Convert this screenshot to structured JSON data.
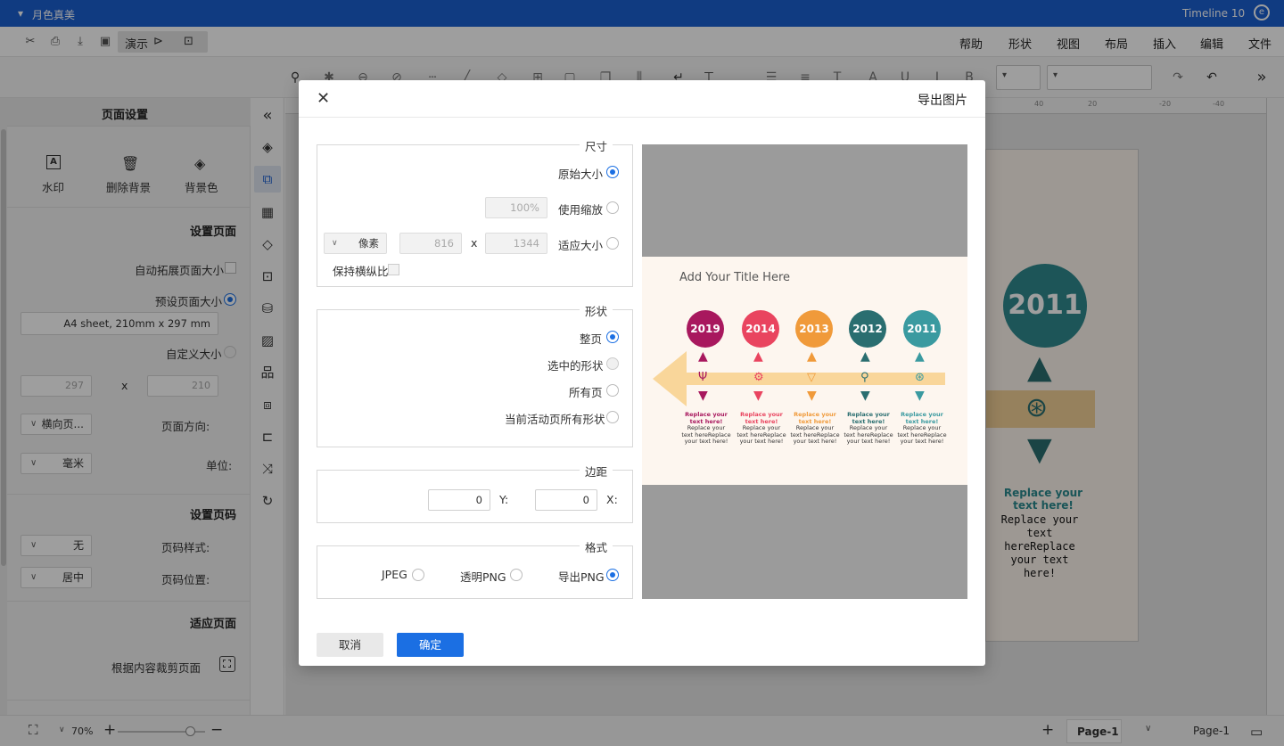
{
  "app": {
    "title": "Timeline 10",
    "user": "月色真美"
  },
  "menu": {
    "items": [
      "文件",
      "编辑",
      "插入",
      "布局",
      "视图",
      "形状",
      "帮助"
    ],
    "present": "演示"
  },
  "left_panel": {
    "title": "页面设置",
    "tools": [
      "背景色",
      "删除背景",
      "水印"
    ],
    "setup_page": {
      "heading": "设置页面",
      "auto_extend": "自动拓展页面大小",
      "preset_size": "预设页面大小",
      "preset_value": "A4 sheet, 210mm x 297 mm",
      "custom_size": "自定义大小",
      "width": "210",
      "height": "297",
      "x": "x",
      "orientation_label": "页面方向:",
      "orientation_value": "横向页...",
      "unit_label": "单位:",
      "unit_value": "毫米"
    },
    "page_number": {
      "heading": "设置页码",
      "style_label": "页码样式:",
      "style_value": "无",
      "position_label": "页码位置:",
      "position_value": "居中"
    },
    "fit_page": {
      "heading": "适应页面",
      "crop_label": "根据内容裁剪页面"
    }
  },
  "statusbar": {
    "page_tab": "Page-1",
    "page_select": "Page-1",
    "zoom": "70%"
  },
  "dialog": {
    "title": "导出图片",
    "size": {
      "legend": "尺寸",
      "original": "原始大小",
      "use_scale": "使用缩放",
      "scale_value": "100%",
      "fit_size": "适应大小",
      "width": "1344",
      "height": "816",
      "x": "x",
      "unit": "像素",
      "keep_ratio": "保持横纵比"
    },
    "shape": {
      "legend": "形状",
      "whole_page": "整页",
      "selected": "选中的形状",
      "all_pages": "所有页",
      "current_all": "当前活动页所有形状"
    },
    "margin": {
      "legend": "边距",
      "x_label": "X:",
      "x_value": "0",
      "y_label": "Y:",
      "y_value": "0"
    },
    "format": {
      "legend": "格式",
      "png": "导出PNG",
      "transparent_png": "透明PNG",
      "jpeg": "JPEG"
    },
    "ok": "确定",
    "cancel": "取消"
  },
  "preview": {
    "title": "Add Your Title Here",
    "years": [
      {
        "label": "2011",
        "color": "#3a9aa0"
      },
      {
        "label": "2012",
        "color": "#2a6e70"
      },
      {
        "label": "2013",
        "color": "#f09a3a"
      },
      {
        "label": "2014",
        "color": "#e9445f"
      },
      {
        "label": "2019",
        "color": "#a8185e"
      }
    ],
    "caption_head": "Replace your text here!",
    "caption_body": "Replace your text hereReplace your text here!"
  },
  "canvas_page": {
    "year": "2011",
    "caption_head": "Replace your text here!",
    "caption_body": "Replace your text hereReplace your text here!"
  }
}
